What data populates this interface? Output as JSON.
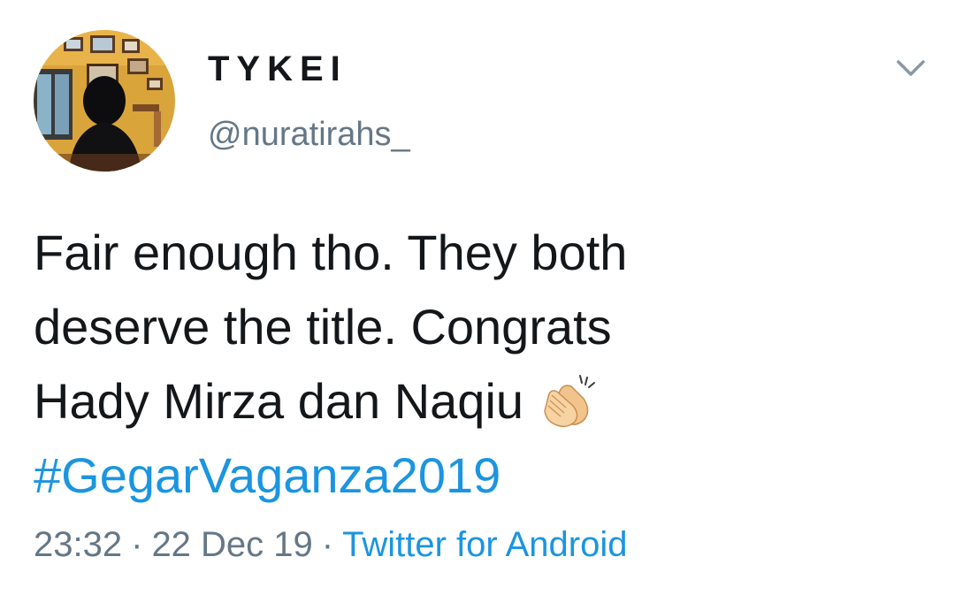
{
  "colors": {
    "text_primary": "#14171a",
    "text_secondary": "#657786",
    "link": "#1b95e0",
    "background": "#ffffff"
  },
  "author": {
    "display_name": "TYKEI",
    "handle": "@nuratirahs_",
    "avatar_icon": "profile-photo"
  },
  "menu": {
    "icon": "chevron-down-icon"
  },
  "tweet": {
    "lines": [
      "Fair enough tho. They both",
      "deserve the title. Congrats",
      "Hady Mirza dan Naqiu"
    ],
    "emoji": "clapping-hands-icon",
    "hashtag": "#GegarVaganza2019"
  },
  "meta": {
    "time": "23:32",
    "separator": "·",
    "date": "22 Dec 19",
    "source": "Twitter for Android"
  }
}
